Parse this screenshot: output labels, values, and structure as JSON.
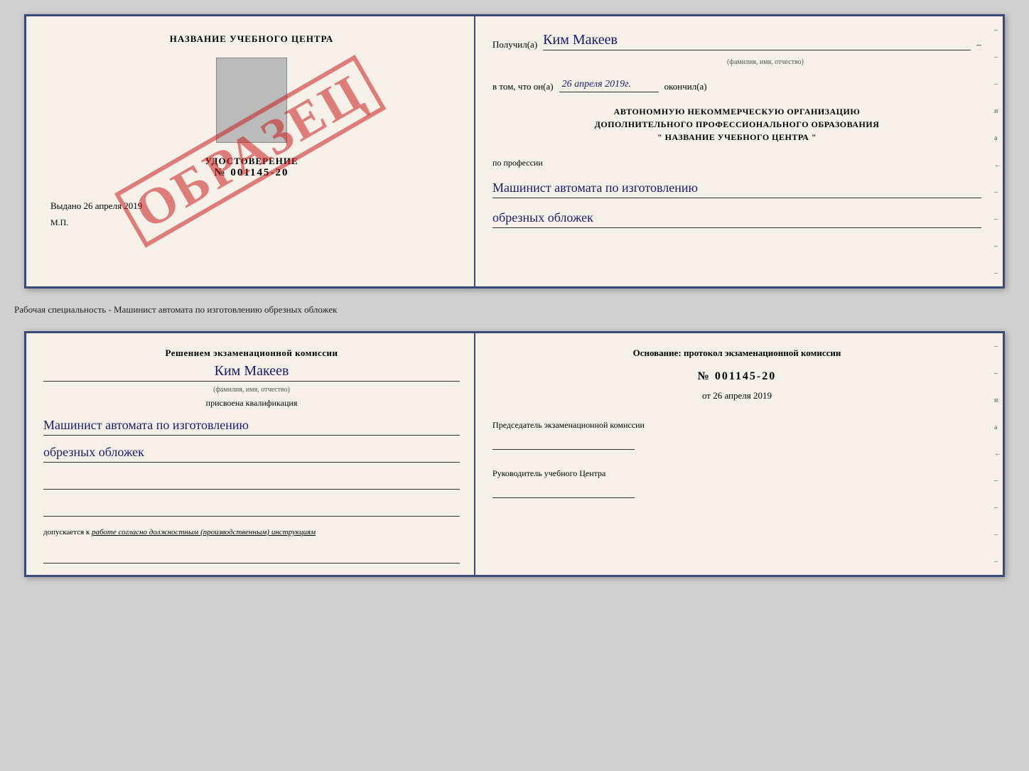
{
  "top_doc": {
    "left": {
      "title": "НАЗВАНИЕ УЧЕБНОГО ЦЕНТРА",
      "stamp": "ОБРАЗЕЦ",
      "udostoverenie_label": "УДОСТОВЕРЕНИЕ",
      "number": "№ 001145-20",
      "vydano_label": "Выдано",
      "vydano_date": "26 апреля 2019",
      "mp_label": "М.П."
    },
    "right": {
      "poluchil_label": "Получил(а)",
      "recipient_name": "Ким Макеев",
      "fio_subtitle": "(фамилия, имя, отчество)",
      "vtom_label": "в том, что он(а)",
      "vtom_date": "26 апреля 2019г.",
      "okonchil_label": "окончил(а)",
      "org_line1": "АВТОНОМНУЮ НЕКОММЕРЧЕСКУЮ ОРГАНИЗАЦИЮ",
      "org_line2": "ДОПОЛНИТЕЛЬНОГО ПРОФЕССИОНАЛЬНОГО ОБРАЗОВАНИЯ",
      "org_quote1": "\"",
      "org_name": "НАЗВАНИЕ УЧЕБНОГО ЦЕНТРА",
      "org_quote2": "\"",
      "po_professii": "по профессии",
      "profession_line1": "Машинист автомата по изготовлению",
      "profession_line2": "обрезных обложек",
      "edge_marks": [
        "-",
        "-",
        "-",
        "и",
        "а",
        "←",
        "-",
        "-",
        "-",
        "-"
      ]
    }
  },
  "separator": {
    "text": "Рабочая специальность - Машинист автомата по изготовлению обрезных обложек"
  },
  "bottom_doc": {
    "left": {
      "komissia_title": "Решением экзаменационной комиссии",
      "komissia_name": "Ким Макеев",
      "fio_subtitle": "(фамилия, имя, отчество)",
      "prisvoena": "присвоена квалификация",
      "kvalif_line1": "Машинист автомата по изготовлению",
      "kvalif_line2": "обрезных обложек",
      "dopuskaetsya_label": "допускается к",
      "dopuskaetsya_text": "работе согласно должностным (производственным) инструкциям"
    },
    "right": {
      "osnov_title": "Основание: протокол экзаменационной комиссии",
      "protocol_number": "№  001145-20",
      "protocol_date_prefix": "от",
      "protocol_date": "26 апреля 2019",
      "predsedatel_label": "Председатель экзаменационной комиссии",
      "rukovod_label": "Руководитель учебного Центра",
      "edge_marks": [
        "-",
        "-",
        "и",
        "а",
        "←",
        "-",
        "-",
        "-",
        "-"
      ]
    }
  }
}
